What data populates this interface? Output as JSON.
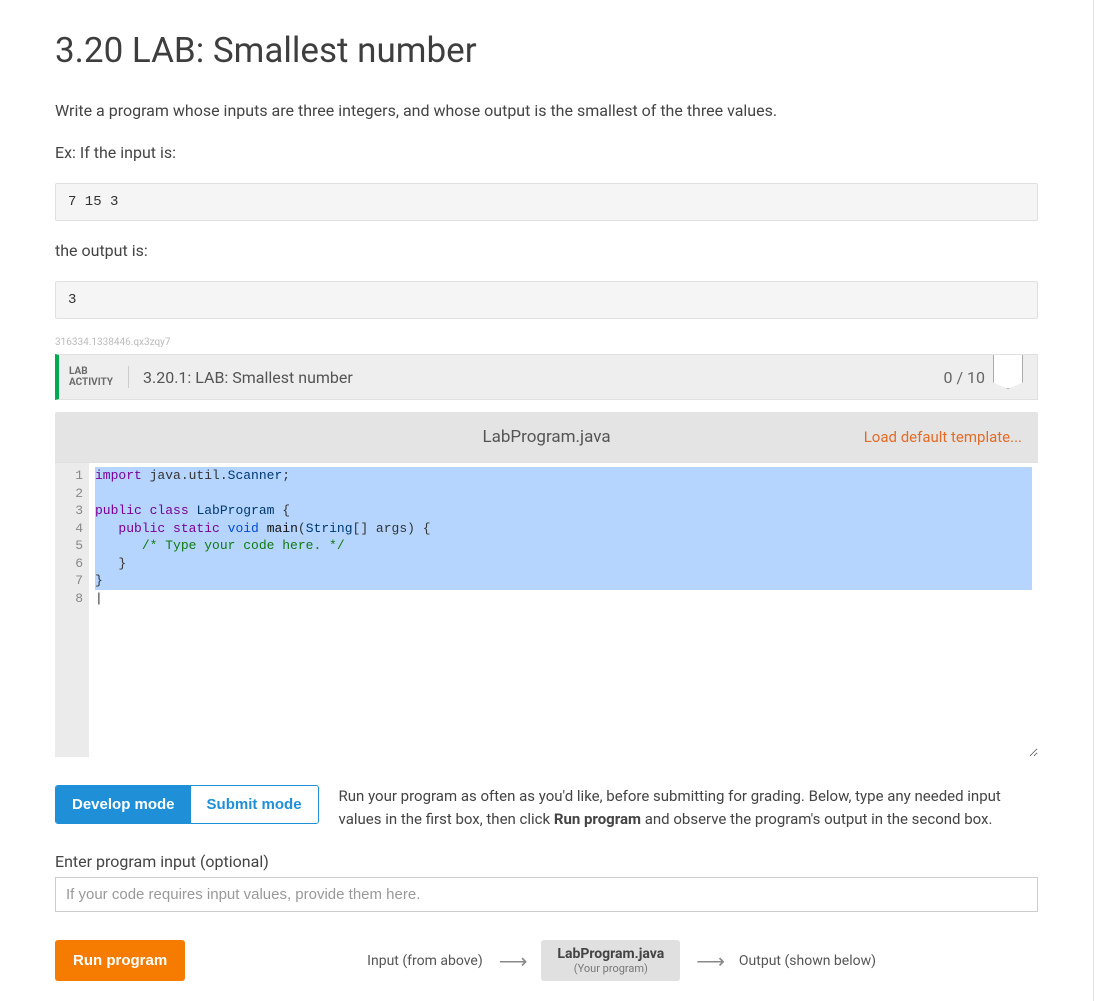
{
  "page": {
    "title": "3.20 LAB: Smallest number",
    "description": "Write a program whose inputs are three integers, and whose output is the smallest of the three values.",
    "example_intro": "Ex: If the input is:",
    "example_input": "7 15 3",
    "output_intro": "the output is:",
    "example_output": "3",
    "small_id": "316334.1338446.qx3zqy7"
  },
  "lab": {
    "label_line1": "LAB",
    "label_line2": "ACTIVITY",
    "title": "3.20.1: LAB: Smallest number",
    "score": "0 / 10"
  },
  "editor": {
    "filename": "LabProgram.java",
    "load_link": "Load default template...",
    "gutter": [
      "1",
      "2",
      "3",
      "4",
      "5",
      "6",
      "7",
      "8"
    ]
  },
  "modes": {
    "develop": "Develop mode",
    "submit": "Submit mode",
    "desc_pre": "Run your program as often as you'd like, before submitting for grading. Below, type any needed input values in the first box, then click ",
    "desc_bold": "Run program",
    "desc_post": " and observe the program's output in the second box."
  },
  "input": {
    "label": "Enter program input (optional)",
    "placeholder": "If your code requires input values, provide them here."
  },
  "run": {
    "button": "Run program",
    "flow_input": "Input (from above)",
    "flow_program_main": "LabProgram.java",
    "flow_program_sub": "(Your program)",
    "flow_output": "Output (shown below)"
  }
}
